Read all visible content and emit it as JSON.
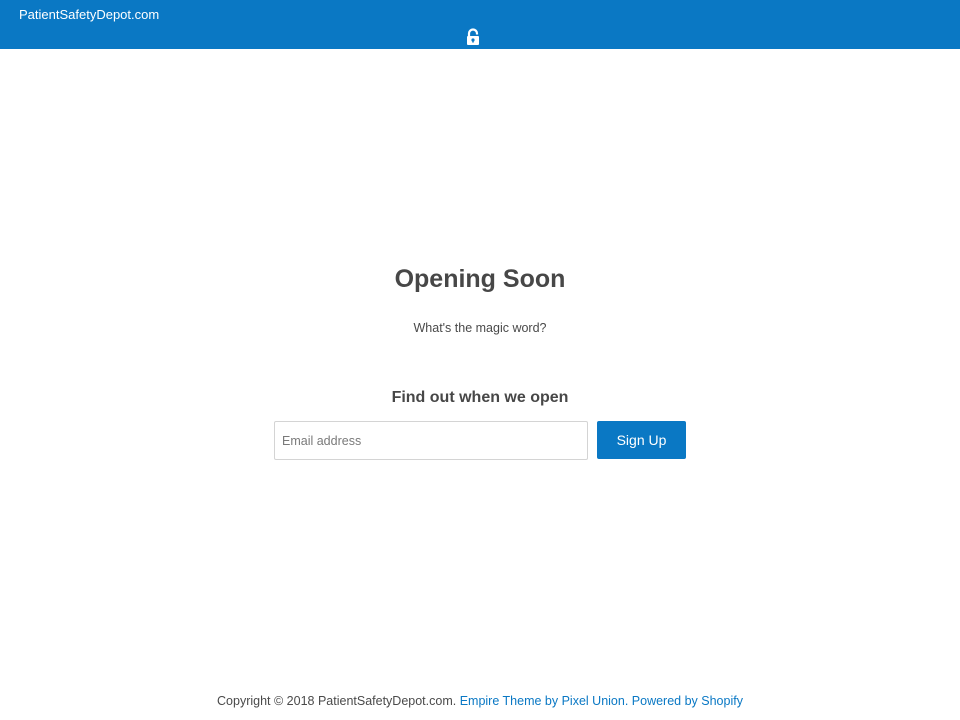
{
  "header": {
    "site_name": "PatientSafetyDepot.com",
    "lock_icon": "lock-icon",
    "background_color": "#0a78c4"
  },
  "main": {
    "title": "Opening Soon",
    "password_prompt": "What's the magic word?",
    "signup_heading": "Find out when we open",
    "email_placeholder": "Email address",
    "email_value": "",
    "signup_button_label": "Sign Up",
    "accent_color": "#0a78c4"
  },
  "footer": {
    "copyright": "Copyright © 2018 PatientSafetyDepot.com.",
    "theme_link": "Empire Theme by Pixel Union.",
    "powered_link": "Powered by Shopify"
  }
}
